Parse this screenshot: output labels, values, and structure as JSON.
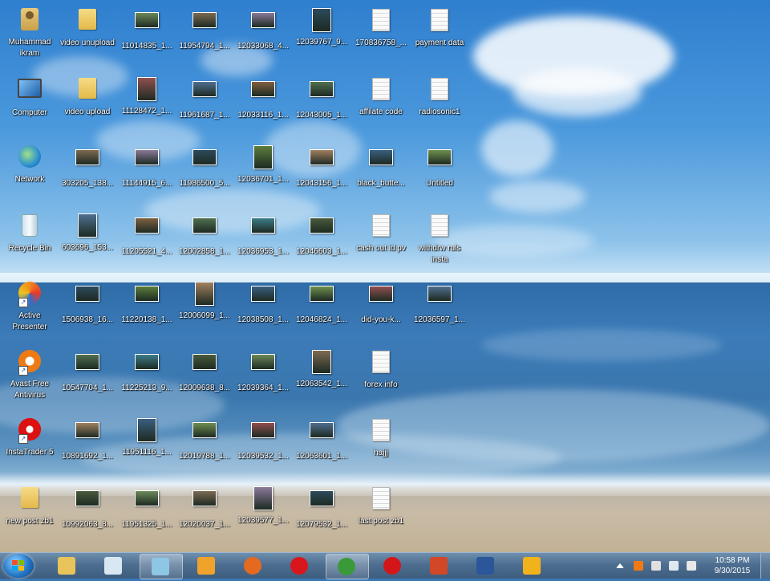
{
  "desktop": {
    "icons": [
      {
        "label": "Muhammad ikram",
        "icon": "user-folder-icon"
      },
      {
        "label": "video unupload",
        "icon": "folder-icon"
      },
      {
        "label": "11014835_1...",
        "icon": "image-icon"
      },
      {
        "label": "11954794_1...",
        "icon": "image-icon"
      },
      {
        "label": "12033068_4...",
        "icon": "image-icon"
      },
      {
        "label": "12039767_9...",
        "icon": "image-icon"
      },
      {
        "label": "170836758_...",
        "icon": "document-icon"
      },
      {
        "label": "payment data",
        "icon": "document-icon"
      },
      {
        "label": "Computer",
        "icon": "computer-icon"
      },
      {
        "label": "video upload",
        "icon": "folder-icon"
      },
      {
        "label": "11128472_1...",
        "icon": "image-icon"
      },
      {
        "label": "11961687_1...",
        "icon": "image-icon"
      },
      {
        "label": "12033116_1...",
        "icon": "image-icon"
      },
      {
        "label": "12043005_1...",
        "icon": "image-icon"
      },
      {
        "label": "affilate code",
        "icon": "document-icon"
      },
      {
        "label": "radiosonic1",
        "icon": "document-icon"
      },
      {
        "label": "Network",
        "icon": "network-icon"
      },
      {
        "label": "303205_138...",
        "icon": "image-icon"
      },
      {
        "label": "11144915_6...",
        "icon": "image-icon"
      },
      {
        "label": "11986500_5...",
        "icon": "image-icon"
      },
      {
        "label": "12036701_1...",
        "icon": "image-icon"
      },
      {
        "label": "12043156_1...",
        "icon": "image-icon"
      },
      {
        "label": "black_butte...",
        "icon": "image-icon"
      },
      {
        "label": "Untitled",
        "icon": "image-icon"
      },
      {
        "label": "Recycle Bin",
        "icon": "recycle-bin-icon"
      },
      {
        "label": "603696_153...",
        "icon": "image-icon"
      },
      {
        "label": "11205521_4...",
        "icon": "image-icon"
      },
      {
        "label": "12002858_1...",
        "icon": "image-icon"
      },
      {
        "label": "12036953_1...",
        "icon": "image-icon"
      },
      {
        "label": "12046603_1...",
        "icon": "image-icon"
      },
      {
        "label": "cash out id pv",
        "icon": "document-icon"
      },
      {
        "label": "withdrw ruls insta",
        "icon": "document-icon"
      },
      {
        "label": "Active Presenter",
        "icon": "active-presenter-icon"
      },
      {
        "label": "1506938_16...",
        "icon": "image-icon"
      },
      {
        "label": "11220138_1...",
        "icon": "image-icon"
      },
      {
        "label": "12006099_1...",
        "icon": "image-icon"
      },
      {
        "label": "12038508_1...",
        "icon": "image-icon"
      },
      {
        "label": "12046824_1...",
        "icon": "image-icon"
      },
      {
        "label": "did-you-k...",
        "icon": "image-icon"
      },
      {
        "label": "12036597_1...",
        "icon": "image-icon"
      },
      {
        "label": "Avast Free Antivirus",
        "icon": "avast-icon"
      },
      {
        "label": "10547704_1...",
        "icon": "image-icon"
      },
      {
        "label": "11225213_9...",
        "icon": "image-icon"
      },
      {
        "label": "12009638_8...",
        "icon": "image-icon"
      },
      {
        "label": "12039364_1...",
        "icon": "image-icon"
      },
      {
        "label": "12063542_1...",
        "icon": "image-icon"
      },
      {
        "label": "forex info",
        "icon": "document-icon"
      },
      null,
      {
        "label": "InstaTrader 5",
        "icon": "instatrader-icon"
      },
      {
        "label": "10891692_1...",
        "icon": "image-icon"
      },
      {
        "label": "11951116_1...",
        "icon": "image-icon"
      },
      {
        "label": "12019788_1...",
        "icon": "image-icon"
      },
      {
        "label": "12039532_1...",
        "icon": "image-icon"
      },
      {
        "label": "12063601_1...",
        "icon": "image-icon"
      },
      {
        "label": "hajjj",
        "icon": "document-icon"
      },
      null,
      {
        "label": "new post zb1",
        "icon": "folder-icon"
      },
      {
        "label": "10992063_8...",
        "icon": "image-icon"
      },
      {
        "label": "11951325_1...",
        "icon": "image-icon"
      },
      {
        "label": "12020037_1...",
        "icon": "image-icon"
      },
      {
        "label": "12039577_1...",
        "icon": "image-icon"
      },
      {
        "label": "12079532_1...",
        "icon": "image-icon"
      },
      {
        "label": "last post zb1",
        "icon": "document-icon"
      },
      null
    ]
  },
  "taskbar": {
    "start_icon": "windows-start-icon",
    "items": [
      {
        "icon": "file-explorer-icon",
        "color": "#e9c45b",
        "active": false
      },
      {
        "icon": "paint-icon",
        "color": "#d8e7f2",
        "active": false
      },
      {
        "icon": "active-presenter-app-icon",
        "color": "#8ec6e6",
        "active": true
      },
      {
        "icon": "media-player-icon",
        "color": "#f0a32b",
        "active": false
      },
      {
        "icon": "firefox-icon",
        "color": "#e46a1f",
        "active": false
      },
      {
        "icon": "opera-icon",
        "color": "#d9161c",
        "active": false
      },
      {
        "icon": "chrome-icon",
        "color": "#3a9a3a",
        "active": true
      },
      {
        "icon": "instatrader-app-icon",
        "color": "#d3161a",
        "active": false
      },
      {
        "icon": "powerpoint-icon",
        "color": "#d24726",
        "active": false
      },
      {
        "icon": "word-icon",
        "color": "#2b579a",
        "active": false
      },
      {
        "icon": "launcher-icon",
        "color": "#f2b21c",
        "active": false
      }
    ],
    "tray_icons": [
      "show-hidden-icons",
      "avast-tray-icon",
      "volume-muted-icon",
      "network-tray-icon",
      "action-center-flag-icon"
    ],
    "clock": {
      "time": "10:58 PM",
      "date": "9/30/2015"
    }
  }
}
